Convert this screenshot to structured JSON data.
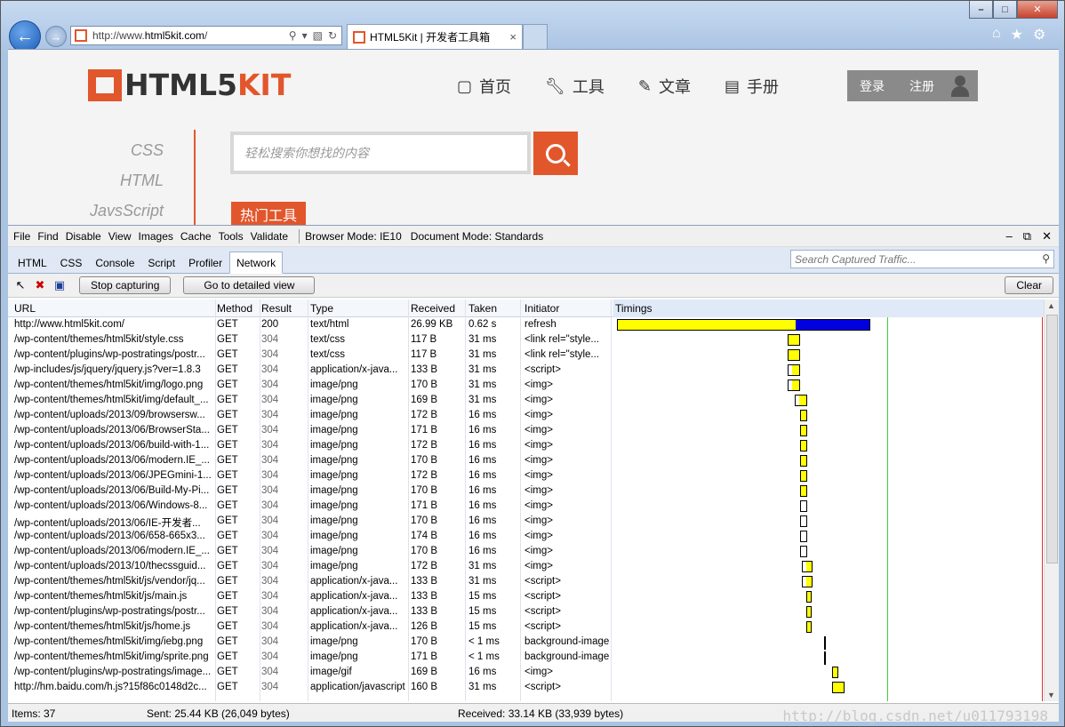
{
  "browser": {
    "url_prefix": "http://www.",
    "url_domain": "html5kit.com",
    "url_suffix": "/",
    "tab_title": "HTML5Kit | 开发者工具箱",
    "tab_close": "×",
    "window_controls": {
      "minimize": "–",
      "maximize": "□",
      "close": "✕"
    }
  },
  "site": {
    "logo_a": "HTML5",
    "logo_b": "KIT",
    "nav": [
      "首页",
      "工具",
      "文章",
      "手册"
    ],
    "login": "登录",
    "register": "注册",
    "side_links": [
      "CSS",
      "HTML",
      "JavsScript"
    ],
    "search_placeholder": "轻松搜索你想找的内容",
    "hot_tools": "热门工具"
  },
  "devtools": {
    "menu": [
      "File",
      "Find",
      "Disable",
      "View",
      "Images",
      "Cache",
      "Tools",
      "Validate"
    ],
    "browser_mode": "Browser Mode: IE10",
    "document_mode": "Document Mode: Standards",
    "tabs": [
      "HTML",
      "CSS",
      "Console",
      "Script",
      "Profiler",
      "Network"
    ],
    "active_tab": "Network",
    "search_placeholder": "Search Captured Traffic...",
    "stop_capturing": "Stop capturing",
    "detailed_view": "Go to detailed view",
    "clear": "Clear",
    "columns": {
      "url": "URL",
      "method": "Method",
      "result": "Result",
      "type": "Type",
      "received": "Received",
      "taken": "Taken",
      "initiator": "Initiator",
      "timings": "Timings"
    },
    "status": {
      "items": "Items: 37",
      "sent": "Sent: 25.44 KB (26,049 bytes)",
      "received": "Received: 33.14 KB (33,939 bytes)",
      "watermark": "http://blog.csdn.net/u011793198"
    }
  },
  "requests": [
    {
      "url": "http://www.html5kit.com/",
      "method": "GET",
      "result": "200",
      "type": "text/html",
      "received": "26.99 KB",
      "taken": "0.62 s",
      "initiator": "refresh"
    },
    {
      "url": "/wp-content/themes/html5kit/style.css",
      "method": "GET",
      "result": "304",
      "type": "text/css",
      "received": "117 B",
      "taken": "31 ms",
      "initiator": "<link rel=\"style..."
    },
    {
      "url": "/wp-content/plugins/wp-postratings/postr...",
      "method": "GET",
      "result": "304",
      "type": "text/css",
      "received": "117 B",
      "taken": "31 ms",
      "initiator": "<link rel=\"style..."
    },
    {
      "url": "/wp-includes/js/jquery/jquery.js?ver=1.8.3",
      "method": "GET",
      "result": "304",
      "type": "application/x-java...",
      "received": "133 B",
      "taken": "31 ms",
      "initiator": "<script>"
    },
    {
      "url": "/wp-content/themes/html5kit/img/logo.png",
      "method": "GET",
      "result": "304",
      "type": "image/png",
      "received": "170 B",
      "taken": "31 ms",
      "initiator": "<img>"
    },
    {
      "url": "/wp-content/themes/html5kit/img/default_...",
      "method": "GET",
      "result": "304",
      "type": "image/png",
      "received": "169 B",
      "taken": "31 ms",
      "initiator": "<img>"
    },
    {
      "url": "/wp-content/uploads/2013/09/browsersw...",
      "method": "GET",
      "result": "304",
      "type": "image/png",
      "received": "172 B",
      "taken": "16 ms",
      "initiator": "<img>"
    },
    {
      "url": "/wp-content/uploads/2013/06/BrowserSta...",
      "method": "GET",
      "result": "304",
      "type": "image/png",
      "received": "171 B",
      "taken": "16 ms",
      "initiator": "<img>"
    },
    {
      "url": "/wp-content/uploads/2013/06/build-with-1...",
      "method": "GET",
      "result": "304",
      "type": "image/png",
      "received": "172 B",
      "taken": "16 ms",
      "initiator": "<img>"
    },
    {
      "url": "/wp-content/uploads/2013/06/modern.IE_...",
      "method": "GET",
      "result": "304",
      "type": "image/png",
      "received": "170 B",
      "taken": "16 ms",
      "initiator": "<img>"
    },
    {
      "url": "/wp-content/uploads/2013/06/JPEGmini-1...",
      "method": "GET",
      "result": "304",
      "type": "image/png",
      "received": "172 B",
      "taken": "16 ms",
      "initiator": "<img>"
    },
    {
      "url": "/wp-content/uploads/2013/06/Build-My-Pi...",
      "method": "GET",
      "result": "304",
      "type": "image/png",
      "received": "170 B",
      "taken": "16 ms",
      "initiator": "<img>"
    },
    {
      "url": "/wp-content/uploads/2013/06/Windows-8...",
      "method": "GET",
      "result": "304",
      "type": "image/png",
      "received": "171 B",
      "taken": "16 ms",
      "initiator": "<img>"
    },
    {
      "url": "/wp-content/uploads/2013/06/IE-开发者...",
      "method": "GET",
      "result": "304",
      "type": "image/png",
      "received": "170 B",
      "taken": "16 ms",
      "initiator": "<img>"
    },
    {
      "url": "/wp-content/uploads/2013/06/658-665x3...",
      "method": "GET",
      "result": "304",
      "type": "image/png",
      "received": "174 B",
      "taken": "16 ms",
      "initiator": "<img>"
    },
    {
      "url": "/wp-content/uploads/2013/06/modern.IE_...",
      "method": "GET",
      "result": "304",
      "type": "image/png",
      "received": "170 B",
      "taken": "16 ms",
      "initiator": "<img>"
    },
    {
      "url": "/wp-content/uploads/2013/10/thecssguid...",
      "method": "GET",
      "result": "304",
      "type": "image/png",
      "received": "172 B",
      "taken": "31 ms",
      "initiator": "<img>"
    },
    {
      "url": "/wp-content/themes/html5kit/js/vendor/jq...",
      "method": "GET",
      "result": "304",
      "type": "application/x-java...",
      "received": "133 B",
      "taken": "31 ms",
      "initiator": "<script>"
    },
    {
      "url": "/wp-content/themes/html5kit/js/main.js",
      "method": "GET",
      "result": "304",
      "type": "application/x-java...",
      "received": "133 B",
      "taken": "15 ms",
      "initiator": "<script>"
    },
    {
      "url": "/wp-content/plugins/wp-postratings/postr...",
      "method": "GET",
      "result": "304",
      "type": "application/x-java...",
      "received": "133 B",
      "taken": "15 ms",
      "initiator": "<script>"
    },
    {
      "url": "/wp-content/themes/html5kit/js/home.js",
      "method": "GET",
      "result": "304",
      "type": "application/x-java...",
      "received": "126 B",
      "taken": "15 ms",
      "initiator": "<script>"
    },
    {
      "url": "/wp-content/themes/html5kit/img/iebg.png",
      "method": "GET",
      "result": "304",
      "type": "image/png",
      "received": "170 B",
      "taken": "< 1 ms",
      "initiator": "background-image"
    },
    {
      "url": "/wp-content/themes/html5kit/img/sprite.png",
      "method": "GET",
      "result": "304",
      "type": "image/png",
      "received": "171 B",
      "taken": "< 1 ms",
      "initiator": "background-image"
    },
    {
      "url": "/wp-content/plugins/wp-postratings/image...",
      "method": "GET",
      "result": "304",
      "type": "image/gif",
      "received": "169 B",
      "taken": "16 ms",
      "initiator": "<img>"
    },
    {
      "url": "http://hm.baidu.com/h.js?15f86c0148d2c...",
      "method": "GET",
      "result": "304",
      "type": "application/javascript",
      "received": "160 B",
      "taken": "31 ms",
      "initiator": "<script>"
    }
  ]
}
